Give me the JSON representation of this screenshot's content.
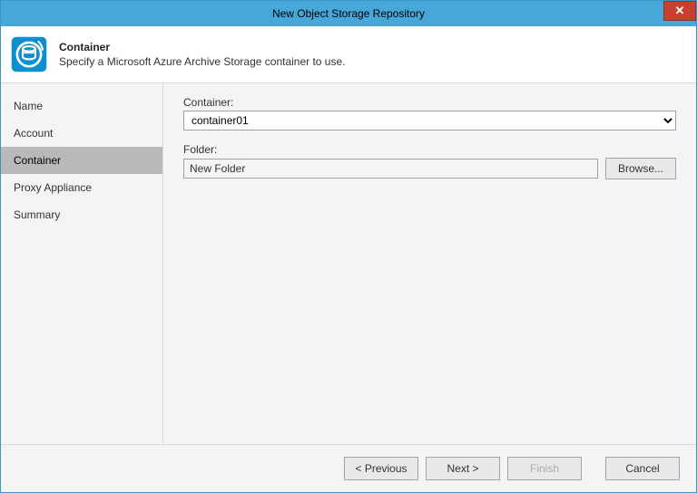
{
  "window": {
    "title": "New Object Storage Repository",
    "close_glyph": "✕"
  },
  "header": {
    "title": "Container",
    "subtitle": "Specify a Microsoft Azure Archive Storage container to use."
  },
  "sidebar": {
    "steps": [
      {
        "label": "Name",
        "active": false
      },
      {
        "label": "Account",
        "active": false
      },
      {
        "label": "Container",
        "active": true
      },
      {
        "label": "Proxy Appliance",
        "active": false
      },
      {
        "label": "Summary",
        "active": false
      }
    ]
  },
  "form": {
    "container_label": "Container:",
    "container_value": "container01",
    "folder_label": "Folder:",
    "folder_value": "New Folder",
    "browse_label": "Browse..."
  },
  "footer": {
    "prev": "< Previous",
    "next": "Next >",
    "finish": "Finish",
    "cancel": "Cancel"
  }
}
